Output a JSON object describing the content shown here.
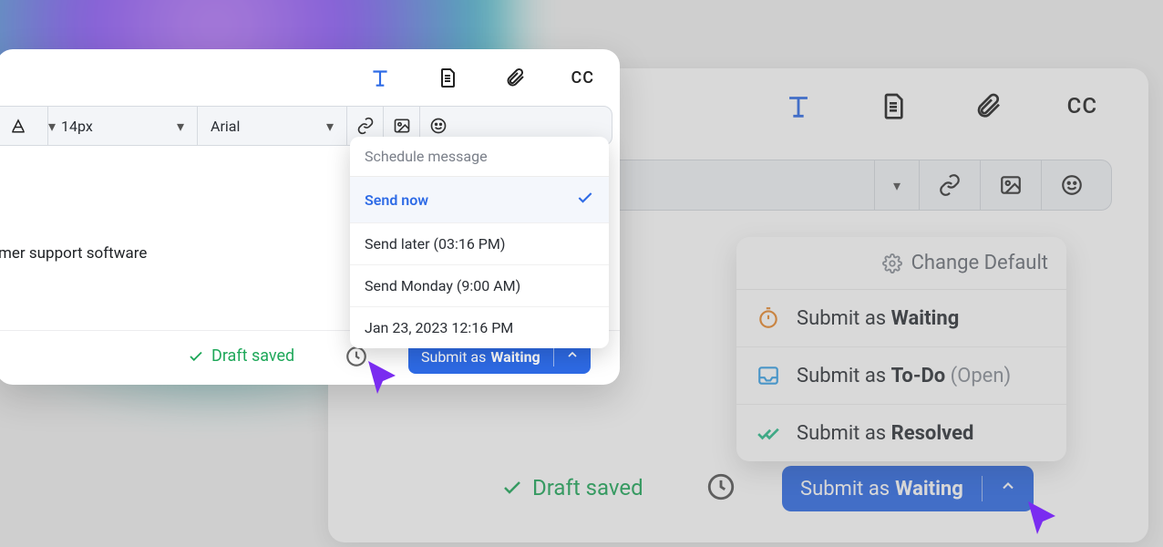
{
  "colors": {
    "accent": "#2e6be6",
    "success": "#1fa85a",
    "cursor": "#7a2cf0"
  },
  "front": {
    "toolbar": {
      "cc_label": "CC"
    },
    "formatbar": {
      "font_size": "14px",
      "font_family": "Arial"
    },
    "body_text": "mer support software",
    "draft_saved": "Draft saved",
    "submit_prefix": "Submit as",
    "submit_status": "Waiting"
  },
  "schedule": {
    "header": "Schedule message",
    "items": [
      {
        "label": "Send now",
        "selected": true
      },
      {
        "label": "Send later (03:16 PM)",
        "selected": false
      },
      {
        "label": "Send Monday (9:00 AM)",
        "selected": false
      },
      {
        "label": "Jan 23, 2023 12:16 PM",
        "selected": false
      }
    ]
  },
  "back": {
    "toolbar": {
      "cc_label": "CC"
    },
    "draft_saved": "Draft saved",
    "submit_prefix": "Submit as",
    "submit_status": "Waiting"
  },
  "status_menu": {
    "change_default": "Change Default",
    "items": [
      {
        "prefix": "Submit as ",
        "status": "Waiting",
        "suffix": "",
        "icon": "stopwatch",
        "color": "#e98a2e"
      },
      {
        "prefix": "Submit as ",
        "status": "To-Do",
        "suffix": " (Open)",
        "icon": "inbox",
        "color": "#3aa2e8"
      },
      {
        "prefix": "Submit as ",
        "status": "Resolved",
        "suffix": "",
        "icon": "double-check",
        "color": "#2bbd8c"
      }
    ]
  }
}
